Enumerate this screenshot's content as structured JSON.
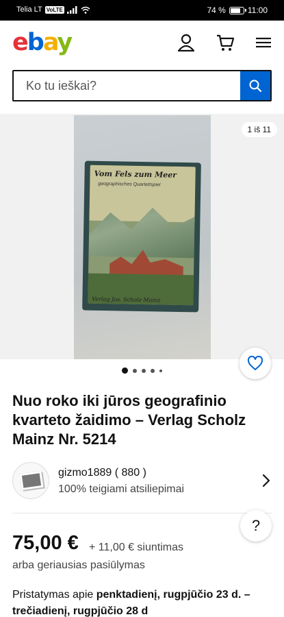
{
  "status_bar": {
    "carrier": "Telia LT",
    "network_badge": "VoLTE",
    "battery": "74 %",
    "time": "11:00"
  },
  "header": {
    "logo": {
      "e": "e",
      "b": "b",
      "a": "a",
      "y": "y"
    },
    "icons": [
      "user-icon",
      "cart-icon",
      "menu-icon"
    ]
  },
  "search": {
    "placeholder": "Ko tu ieškai?",
    "button_icon": "search-icon"
  },
  "gallery": {
    "counter": "1 iš 11",
    "photo": {
      "box_title": "Vom Fels zum Meer",
      "box_subtitle": "geographisches Quartettspiel",
      "box_footer": "Verlag Jos. Scholz Mainz"
    },
    "dots_total": 5,
    "active_dot": 1
  },
  "item": {
    "title": "Nuo roko iki jūros geografinio kvarteto žaidimo – Verlag Scholz Mainz Nr. 5214"
  },
  "seller": {
    "name": "gizmo1889 ( 880 )",
    "feedback": "100% teigiami atsiliepimai"
  },
  "help_label": "?",
  "pricing": {
    "price": "75,00 €",
    "shipping": "+ 11,00 € siuntimas",
    "offer": "arba geriausias pasiūlymas"
  },
  "delivery": {
    "prefix": "Pristatymas apie ",
    "window": "penktadienį, rugpjūčio 23 d. – trečiadienį, rugpjūčio 28 d"
  },
  "colors": {
    "ebay_red": "#e53238",
    "ebay_blue": "#0064d2",
    "ebay_yellow": "#f5af02",
    "ebay_green": "#86b817"
  }
}
